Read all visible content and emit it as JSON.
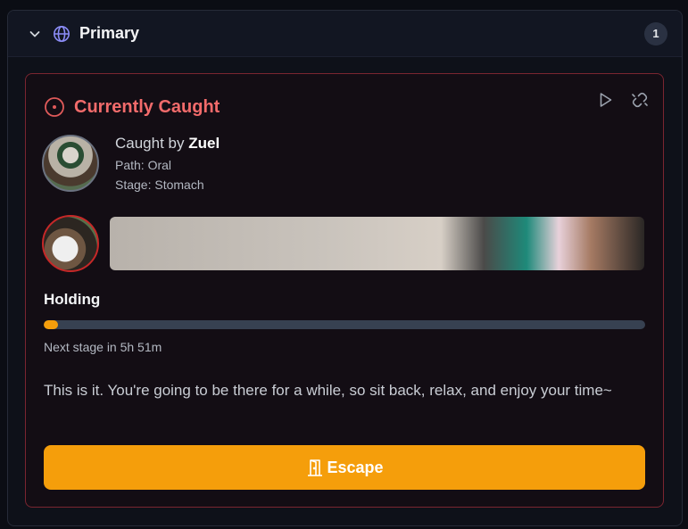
{
  "panel": {
    "title": "Primary",
    "count": "1",
    "icons": [
      "chevron-down-icon",
      "globe-icon"
    ]
  },
  "card": {
    "title": "Currently Caught",
    "accent_color": "#f26b6b",
    "border_color": "#7a2530",
    "icons": [
      "target-icon",
      "play-icon",
      "unlink-icon"
    ],
    "captor": {
      "caught_by_prefix": "Caught by",
      "name": "Zuel",
      "path": "Path: Oral",
      "stage": "Stage: Stomach"
    },
    "holding": {
      "label": "Holding",
      "progress_fraction": 0.024,
      "progress_color": "#f59e0b",
      "next_stage": "Next stage in 5h 51m"
    },
    "description": "This is it. You're going to be there for a while, so sit back, relax, and enjoy your time~",
    "escape_button": {
      "label": "Escape",
      "icon": "door-open-icon",
      "color": "#f59e0b"
    }
  }
}
